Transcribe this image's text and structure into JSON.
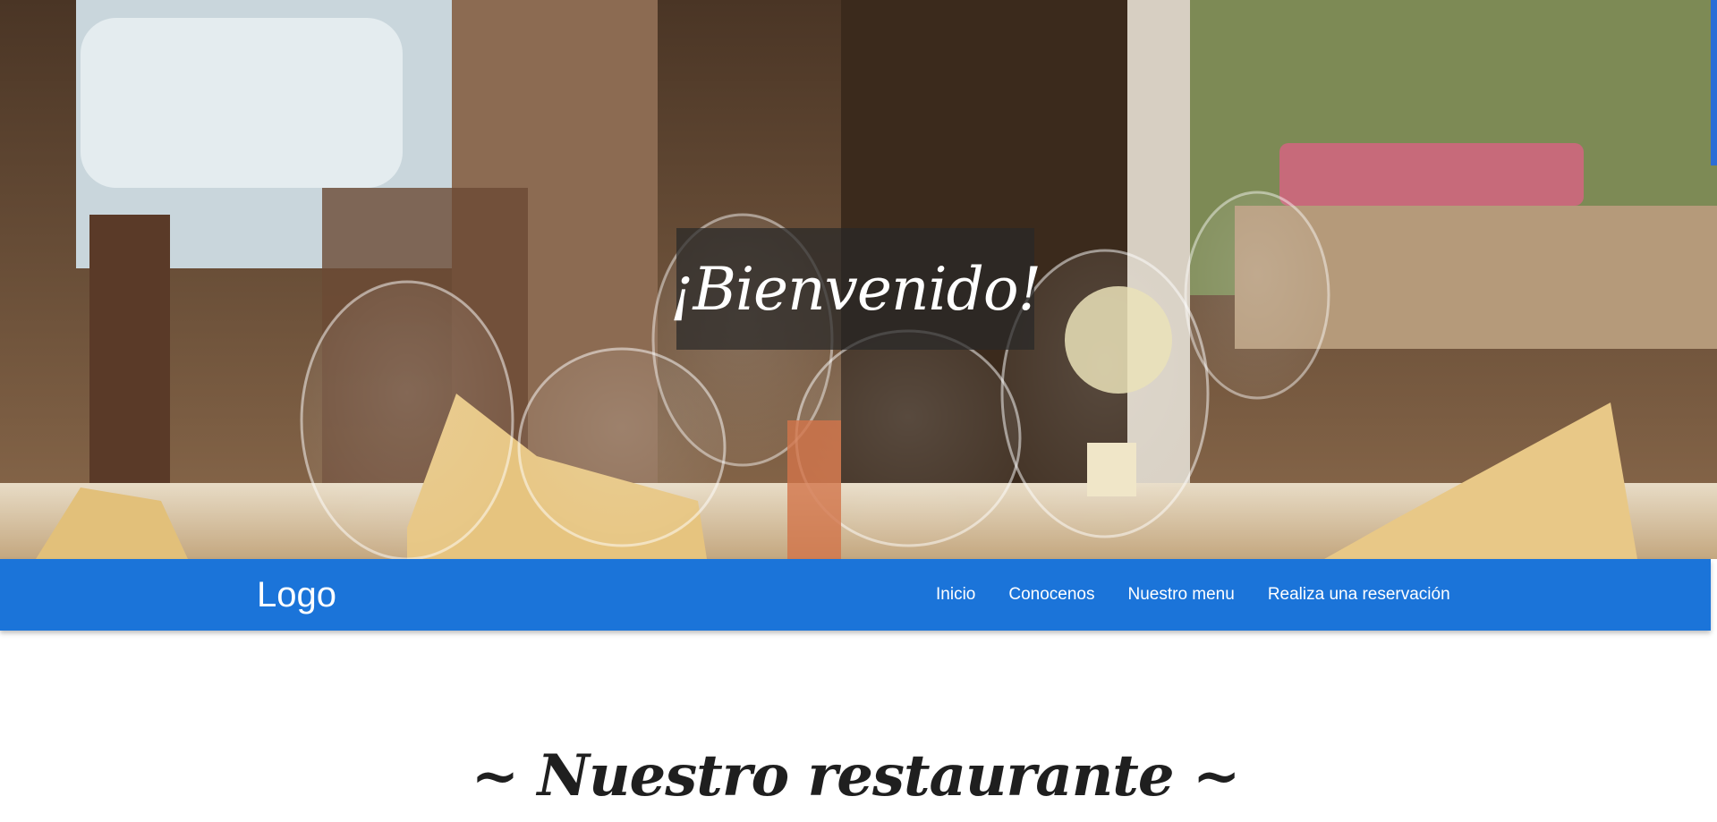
{
  "hero": {
    "title": "¡Bienvenido!",
    "image_description_icon": "restaurant-table-photo"
  },
  "navbar": {
    "logo": "Logo",
    "links": [
      {
        "label": "Inicio"
      },
      {
        "label": "Conocenos"
      },
      {
        "label": "Nuestro menu"
      },
      {
        "label": "Realiza una reservación"
      }
    ],
    "color": "#1b74d9"
  },
  "section": {
    "title": "~ Nuestro restaurante ~"
  },
  "colors": {
    "accent": "#1b74d9",
    "hero_overlay": "#282828",
    "text_dark": "#1f1f1f"
  }
}
